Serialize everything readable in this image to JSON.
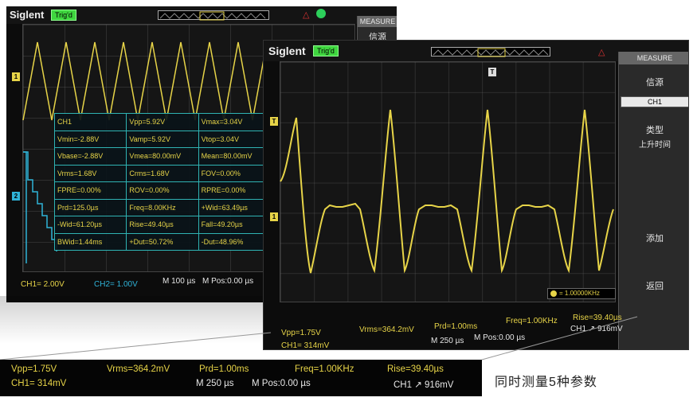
{
  "colors": {
    "ch1_yellow": "#e7d448",
    "ch2_cyan": "#2fb3d8",
    "table_border": "#2fb3b3",
    "trig_green": "#3fd63f",
    "background": "#ffffff"
  },
  "back_scope": {
    "brand": "Siglent",
    "trigger_state": "Trig'd",
    "menu_title": "MEASURE",
    "menu_label": "信源",
    "measurements": [
      [
        "CH1",
        "Vpp=5.92V",
        "Vmax=3.04V"
      ],
      [
        "Vmin=-2.88V",
        "Vamp=5.92V",
        "Vtop=3.04V"
      ],
      [
        "Vbase=-2.88V",
        "Vmea=80.00mV",
        "Mean=80.00mV"
      ],
      [
        "Vrms=1.68V",
        "Crms=1.68V",
        "FOV=0.00%"
      ],
      [
        "FPRE=0.00%",
        "ROV=0.00%",
        "RPRE=0.00%"
      ],
      [
        "Prd=125.0µs",
        "Freq=8.00KHz",
        "+Wid=63.49µs"
      ],
      [
        "-Wid=61.20µs",
        "Rise=49.40µs",
        "Fall=49.20µs"
      ],
      [
        "BWid=1.44ms",
        "+Dut=50.72%",
        "-Dut=48.96%"
      ]
    ],
    "status": {
      "ch1_scale": "CH1= 2.00V",
      "ch2_scale": "CH2= 1.00V",
      "timebase": "M 100 µs",
      "position": "M Pos:0.00 µs"
    }
  },
  "front_scope": {
    "brand": "Siglent",
    "trigger_state": "Trig'd",
    "menu": {
      "title": "MEASURE",
      "source_label": "信源",
      "source_value": "CH1",
      "type_label": "类型",
      "type_value": "上升时间",
      "add_button": "添加",
      "back_button": "返回"
    },
    "freq_badge": "= 1.00000KHz",
    "status": {
      "vpp": "Vpp=1.75V",
      "vrms": "Vrms=364.2mV",
      "prd": "Prd=1.00ms",
      "freq": "Freq=1.00KHz",
      "rise": "Rise=39.40µs",
      "ch1_scale": "CH1= 314mV",
      "timebase": "M 250 µs",
      "position": "M Pos:0.00 µs",
      "trigger": "CH1 ↗ 916mV"
    }
  },
  "bottom_strip": {
    "vpp": "Vpp=1.75V",
    "vrms": "Vrms=364.2mV",
    "prd": "Prd=1.00ms",
    "freq": "Freq=1.00KHz",
    "rise": "Rise=39.40µs",
    "ch1_scale": "CH1= 314mV",
    "timebase": "M 250 µs",
    "position": "M Pos:0.00 µs",
    "trigger": "CH1 ↗ 916mV"
  },
  "caption": "同时测量5种参数"
}
